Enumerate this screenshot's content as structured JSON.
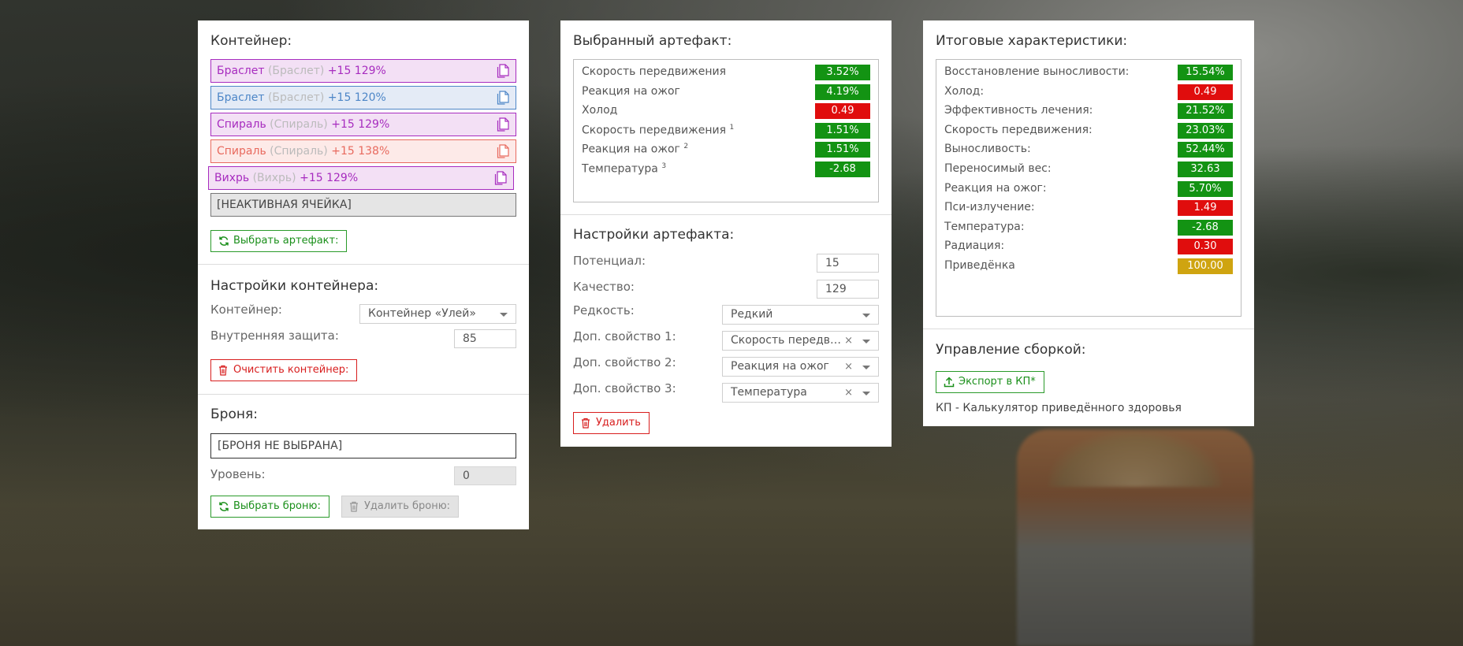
{
  "colors": {
    "green": "#139313",
    "red": "#e00d0d",
    "yellow": "#cfa410",
    "purple_text": "#a72cbf",
    "purple_bg": "#f3e0f5",
    "blue_text": "#4d86c7",
    "blue_bg": "#e4ebf6",
    "salmon_text": "#e86a5e",
    "salmon_bg": "#fdeae8"
  },
  "container": {
    "heading": "Контейнер:",
    "slots": [
      {
        "name": "Браслет",
        "type": "(Браслет)",
        "stats": "+15 129%",
        "style": "purple"
      },
      {
        "name": "Браслет",
        "type": "(Браслет)",
        "stats": "+15 120%",
        "style": "blue"
      },
      {
        "name": "Спираль",
        "type": "(Спираль)",
        "stats": "+15 129%",
        "style": "purple"
      },
      {
        "name": "Спираль",
        "type": "(Спираль)",
        "stats": "+15 138%",
        "style": "salmon"
      },
      {
        "name": "Вихрь",
        "type": "(Вихрь)",
        "stats": "+15 129%",
        "style": "purple"
      }
    ],
    "inactive_slot": "[НЕАКТИВНАЯ ЯЧЕЙКА]",
    "select_button": "Выбрать артефакт:"
  },
  "container_settings": {
    "heading": "Настройки контейнера:",
    "container_label": "Контейнер:",
    "container_value": "Контейнер «Улей»",
    "protection_label": "Внутренняя защита:",
    "protection_value": "85",
    "clear_button": "Очистить контейнер:"
  },
  "armor": {
    "heading": "Броня:",
    "value": "[БРОНЯ НЕ ВЫБРАНА]",
    "level_label": "Уровень:",
    "level_value": "0",
    "select_button": "Выбрать броню:",
    "remove_button": "Удалить броню:"
  },
  "selected_artifact": {
    "heading": "Выбранный артефакт:",
    "stats": [
      {
        "label": "Скорость передвижения",
        "sup": "",
        "value": "3.52%",
        "color": "green"
      },
      {
        "label": "Реакция на ожог",
        "sup": "",
        "value": "4.19%",
        "color": "green"
      },
      {
        "label": "Холод",
        "sup": "",
        "value": "0.49",
        "color": "red"
      },
      {
        "label": "Скорость передвижения",
        "sup": "1",
        "value": "1.51%",
        "color": "green"
      },
      {
        "label": "Реакция на ожог",
        "sup": "2",
        "value": "1.51%",
        "color": "green"
      },
      {
        "label": "Температура",
        "sup": "3",
        "value": "-2.68",
        "color": "green"
      }
    ]
  },
  "artifact_settings": {
    "heading": "Настройки артефакта:",
    "potential_label": "Потенциал:",
    "potential_value": "15",
    "quality_label": "Качество:",
    "quality_value": "129",
    "rarity_label": "Редкость:",
    "rarity_value": "Редкий",
    "extra1_label": "Доп. свойство 1:",
    "extra1_value": "Скорость передвижения",
    "extra2_label": "Доп. свойство 2:",
    "extra2_value": "Реакция на ожог",
    "extra3_label": "Доп. свойство 3:",
    "extra3_value": "Температура",
    "clear_glyph": "×",
    "delete_button": "Удалить"
  },
  "totals": {
    "heading": "Итоговые характеристики:",
    "stats": [
      {
        "label": "Восстановление выносливости:",
        "value": "15.54%",
        "color": "green"
      },
      {
        "label": "Холод:",
        "value": "0.49",
        "color": "red"
      },
      {
        "label": "Эффективность лечения:",
        "value": "21.52%",
        "color": "green"
      },
      {
        "label": "Скорость передвижения:",
        "value": "23.03%",
        "color": "green"
      },
      {
        "label": "Выносливость:",
        "value": "52.44%",
        "color": "green"
      },
      {
        "label": "Переносимый вес:",
        "value": "32.63",
        "color": "green"
      },
      {
        "label": "Реакция на ожог:",
        "value": "5.70%",
        "color": "green"
      },
      {
        "label": "Пси-излучение:",
        "value": "1.49",
        "color": "red"
      },
      {
        "label": "Температура:",
        "value": "-2.68",
        "color": "green"
      },
      {
        "label": "Радиация:",
        "value": "0.30",
        "color": "red"
      },
      {
        "label": "Приведёнка",
        "value": "100.00",
        "color": "yellow"
      }
    ]
  },
  "build": {
    "heading": "Управление сборкой:",
    "export_button": "Экспорт в КП*",
    "note": "КП - Калькулятор приведённого здоровья"
  }
}
